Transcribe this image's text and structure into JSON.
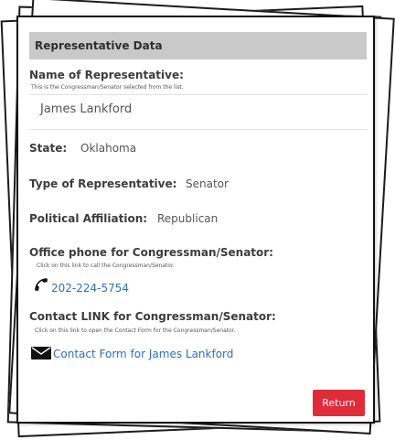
{
  "header": {
    "title": "Representative Data"
  },
  "name_section": {
    "label": "Name of Representative:",
    "hint": "This is the Congressman/Senator selected from the list.",
    "value": "James Lankford"
  },
  "state": {
    "label": "State:",
    "value": "Oklahoma"
  },
  "type": {
    "label": "Type of Representative:",
    "value": "Senator"
  },
  "affiliation": {
    "label": "Political Affiliation:",
    "value": "Republican"
  },
  "phone": {
    "label": "Office phone for Congressman/Senator:",
    "hint": "Click on this link to call the Congressman/Senator.",
    "link": "202-224-5754",
    "icon": "phone-icon"
  },
  "contact": {
    "label": "Contact LINK for Congressman/Senator:",
    "hint": "Click on this link to open the Contact Form for the Congressman/Senator.",
    "link": "Contact Form for James Lankford",
    "icon": "envelope-icon"
  },
  "actions": {
    "return_label": "Return"
  },
  "colors": {
    "accent_button": "#e02b3a",
    "link": "#2f6fc4",
    "header_bg": "#c9c9c9"
  }
}
